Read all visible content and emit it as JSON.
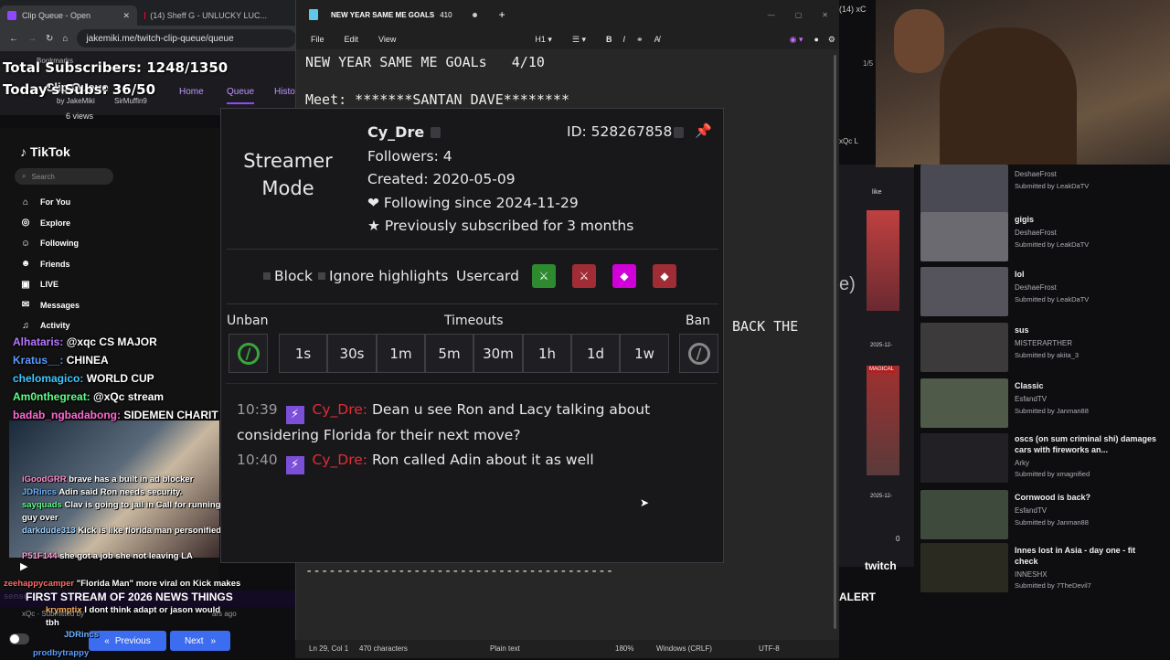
{
  "browser": {
    "tabs": [
      "Clip Queue - Open",
      "(14) Sheff G - UNLUCKY LUC..."
    ],
    "right_tab": "(14) xC",
    "url": "jakemiki.me/twitch-clip-queue/queue"
  },
  "overlay": {
    "total_subs": "Total Subscribers: 1248/1350",
    "today_subs": "Today's Subs: 36/50",
    "marquee": "FIRST STREAM OF 2026  NEWS  THINGS",
    "marquee_right": "ALERT"
  },
  "clip_queue_nav": {
    "title": "Clip Queue",
    "author": "by JakeMiki",
    "views": "6 views",
    "home": "Home",
    "queue": "Queue",
    "history": "Histo",
    "uploader": "SirMuffin9",
    "bookmarks": "Bookmarks"
  },
  "tiktok": {
    "logo": "TikTok",
    "search_placeholder": "Search",
    "nav": [
      "For You",
      "Explore",
      "Following",
      "Friends",
      "LIVE",
      "Messages",
      "Activity"
    ]
  },
  "chat_big": [
    {
      "user": "Alhataris:",
      "msg": " @xqc CS MAJOR",
      "color": "#b678ff"
    },
    {
      "user": "Kratus__:",
      "msg": " CHINEA",
      "color": "#5b9bff"
    },
    {
      "user": "chelomagico:",
      "msg": " WORLD CUP",
      "color": "#3cc8ff"
    },
    {
      "user": "Am0nthegreat:",
      "msg": " @xQc  stream",
      "color": "#5dff8a"
    },
    {
      "user": "badab_ngbadabong:",
      "msg": " SIDEMEN CHARIT",
      "color": "#ff6bd5"
    }
  ],
  "chat_small": [
    {
      "user": "iGoodGRR",
      "msg": "brave has a built in ad blocker",
      "color": "#ff8fd0"
    },
    {
      "user": "JDRincs",
      "msg": "Adin said Ron needs security.",
      "color": "#6fb3ff"
    },
    {
      "user": "sayquads",
      "msg": "Clav is going to jail in Call for running that guy over",
      "color": "#5dff8a"
    },
    {
      "user": "darkdude313",
      "msg": "Kick is like florida man personified",
      "color": "#9fd3ff"
    },
    {
      "user": "P51F144",
      "msg": "she got a job she not leaving LA",
      "color": "#ff9ad5"
    },
    {
      "user": "zeehappycamper",
      "msg": "\"Florida Man\" more viral on Kick makes sense",
      "color": "#ff6b6b"
    },
    {
      "user": "krymptix",
      "msg": "I dont think adapt or jason would tbh",
      "color": "#ffb35d"
    },
    {
      "user": "JDRincs",
      "msg": "",
      "color": "#6fb3ff"
    },
    {
      "user": "prodbytrappy",
      "msg": "",
      "color": "#5b9bff"
    }
  ],
  "clip_footer": {
    "submitted": "xQc · Submitted by",
    "time_ago": "ars ago",
    "prev": "Previous",
    "next": "Next"
  },
  "notepad": {
    "title": "NEW YEAR SAME ME GOALS",
    "title_count": "410",
    "menu": [
      "File",
      "Edit",
      "View"
    ],
    "heading_select": "H1",
    "line1": "NEW YEAR SAME ME GOALs   4/10",
    "line2": "Meet: *******SANTAN DAVE********",
    "right_fragment": "BACK THE",
    "dashes": "----------------------------------------",
    "status": {
      "pos": "Ln 29, Col 1",
      "chars": "470 characters",
      "format": "Plain text",
      "zoom": "180%",
      "eol": "Windows (CRLF)",
      "enc": "UTF-8"
    }
  },
  "usercard": {
    "mode_label": "Streamer\nMode",
    "username": "Cy_Dre",
    "id_label": "ID: 528267858",
    "followers": "Followers: 4",
    "created": "Created: 2020-05-09",
    "following": "❤ Following since 2024-11-29",
    "subscribed": "★ Previously subscribed for 3 months",
    "block": "Block",
    "ignore": "Ignore highlights",
    "usercard_btn": "Usercard",
    "unban": "Unban",
    "timeouts_label": "Timeouts",
    "ban": "Ban",
    "timeouts": [
      "1s",
      "30s",
      "1m",
      "5m",
      "30m",
      "1h",
      "1d",
      "1w"
    ],
    "messages": [
      {
        "time": "10:39",
        "user": "Cy_Dre:",
        "text": "Dean u see Ron and Lacy talking about considering Florida for their next move?"
      },
      {
        "time": "10:40",
        "user": "Cy_Dre:",
        "text": "Ron called Adin about it as well"
      }
    ]
  },
  "clips": [
    {
      "title": "",
      "user": "DeshaeFrost",
      "sub": "Submitted by LeakDaTV",
      "color": "#4a4a55"
    },
    {
      "title": "gigis",
      "user": "DeshaeFrost",
      "sub": "Submitted by LeakDaTV",
      "color": "#6b6a70"
    },
    {
      "title": "lol",
      "user": "DeshaeFrost",
      "sub": "Submitted by LeakDaTV",
      "color": "#55545c"
    },
    {
      "title": "sus",
      "user": "MISTERARTHER",
      "sub": "Submitted by akita_3",
      "color": "#3c3a3a"
    },
    {
      "title": "Classic",
      "user": "EsfandTV",
      "sub": "Submitted by Janman88",
      "color": "#4f5a48"
    },
    {
      "title": "oscs (on sum criminal shi) damages cars with fireworks an...",
      "user": "Arky",
      "sub": "Submitted by xmagnified",
      "color": "#222024"
    },
    {
      "title": "Cornwood is back?",
      "user": "EsfandTV",
      "sub": "Submitted by Janman88",
      "color": "#3e4a3c"
    },
    {
      "title": "Innes lost in Asia - day one - fit check",
      "user": "INNESHX",
      "sub": "Submitted by 7TheDevil7",
      "color": "#2a2a20"
    }
  ],
  "game_strip": {
    "like": "like",
    "xqc": "xQc L",
    "magical": "MAGICAL",
    "date1": "2025-12-",
    "date2": "2025-12-",
    "zero": "0",
    "twitch": "twitch",
    "page": "1/5",
    "paren": "e)"
  },
  "colors": {
    "accent": "#9146ff",
    "red_user": "#e02d35",
    "pink_sub": "#ff00ff",
    "green_btn": "#3a9b3a",
    "blue_btn": "#3c6cf0"
  }
}
